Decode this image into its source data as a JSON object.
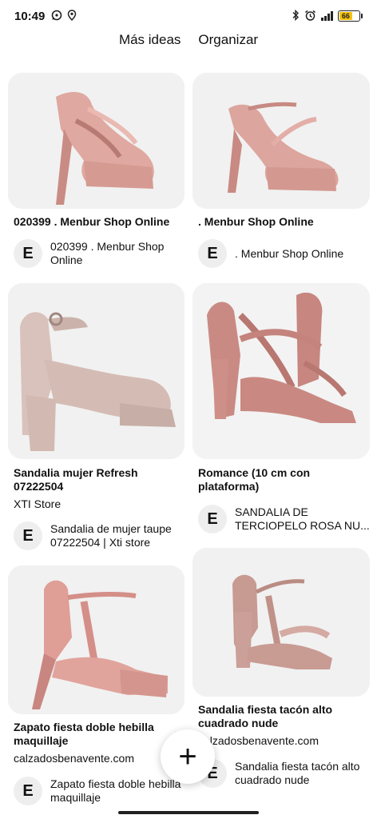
{
  "status_bar": {
    "time": "10:49",
    "battery_level": "66"
  },
  "tabs": {
    "more_ideas": "Más ideas",
    "organize": "Organizar"
  },
  "pins": [
    {
      "title": "020399 . Menbur Shop Online",
      "avatar_letter": "E",
      "attribution": "020399 . Menbur Shop Online"
    },
    {
      "title": ". Menbur Shop Online",
      "avatar_letter": "E",
      "attribution": ". Menbur Shop Online"
    },
    {
      "title": "Sandalia mujer Refresh 07222504",
      "source": "XTI Store",
      "avatar_letter": "E",
      "attribution": "Sandalia de mujer taupe 07222504 | Xti store"
    },
    {
      "title": "Romance (10 cm con plataforma)",
      "avatar_letter": "E",
      "attribution": "SANDALIA DE TERCIOPELO ROSA NU..."
    },
    {
      "title": "Zapato fiesta doble hebilla maquillaje",
      "source": "calzadosbenavente.com",
      "avatar_letter": "E",
      "attribution": "Zapato fiesta doble hebilla maquillaje"
    },
    {
      "title": "Sandalia fiesta tacón alto cuadrado nude",
      "source": "calzadosbenavente.com",
      "avatar_letter": "E",
      "attribution": "Sandalia fiesta tacón alto cuadrado nude"
    }
  ],
  "fab": {
    "label": "+"
  },
  "icons": {
    "whatsapp": "whatsapp-icon",
    "location": "location-icon",
    "bluetooth": "bluetooth-icon",
    "alarm": "alarm-icon",
    "signal": "signal-icon",
    "battery": "battery-icon",
    "add": "plus-icon"
  }
}
